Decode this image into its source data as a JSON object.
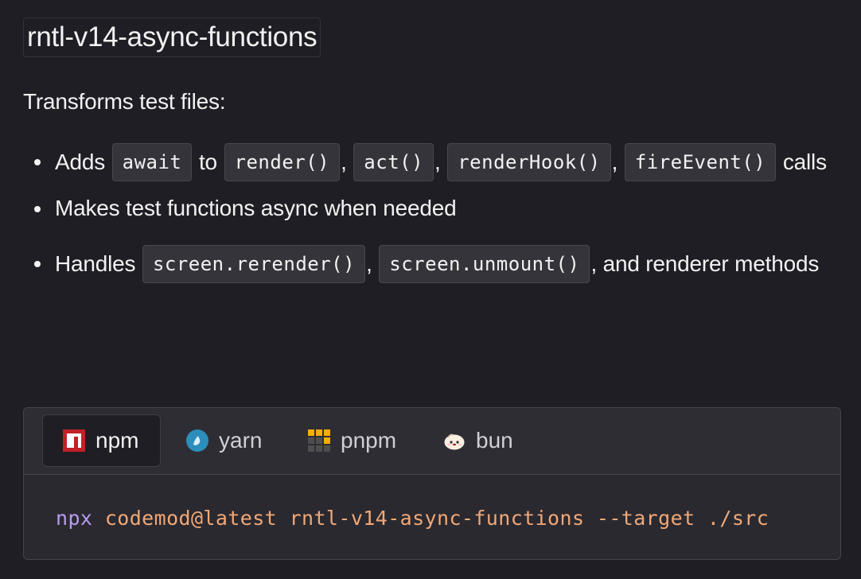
{
  "title": "rntl-v14-async-functions",
  "intro": "Transforms test files:",
  "features": {
    "item1": {
      "prefix": "Adds",
      "code1": "await",
      "to": "to",
      "code2": "render()",
      "sep1": ",",
      "code3": "act()",
      "sep2": ",",
      "code4": "renderHook()",
      "sep3": ",",
      "code5": "fireEvent()",
      "suffix": "calls"
    },
    "item2": {
      "text": "Makes test functions async when needed"
    },
    "item3": {
      "prefix": "Handles",
      "code1": "screen.rerender()",
      "sep1": ",",
      "code2": "screen.unmount()",
      "suffix": ", and renderer methods"
    }
  },
  "install_tabs": {
    "active": "npm",
    "tabs": [
      {
        "label": "npm",
        "icon": "npm-icon"
      },
      {
        "label": "yarn",
        "icon": "yarn-icon"
      },
      {
        "label": "pnpm",
        "icon": "pnpm-icon"
      },
      {
        "label": "bun",
        "icon": "bun-icon"
      }
    ],
    "command": {
      "runner": "npx",
      "rest": "codemod@latest rntl-v14-async-functions --target ./src"
    }
  },
  "colors": {
    "background": "#1f1e24",
    "command_runner": "#b79cf0",
    "command_args": "#f0a877",
    "npm_red": "#c12127",
    "yarn_blue": "#2c8ebb",
    "pnpm_yellow": "#f9ad00"
  }
}
